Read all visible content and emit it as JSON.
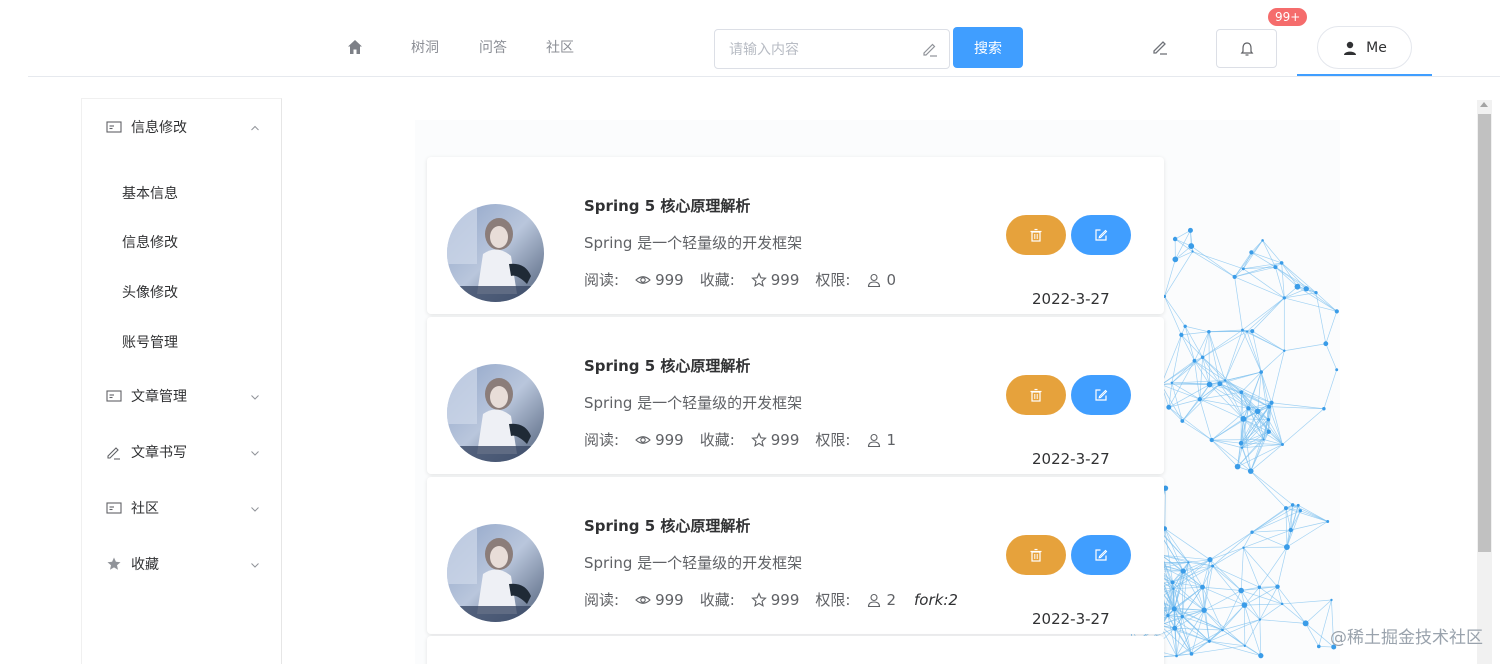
{
  "nav": {
    "links": [
      "树洞",
      "问答",
      "社区"
    ],
    "search_placeholder": "请输入内容",
    "search_button": "搜索",
    "badge": "99+",
    "me_label": "Me"
  },
  "sidebar": {
    "groups": [
      {
        "label": "信息修改",
        "icon": "id-card-icon",
        "expanded": true
      },
      {
        "label": "文章管理",
        "icon": "id-card-icon",
        "expanded": false
      },
      {
        "label": "文章书写",
        "icon": "pen-icon",
        "expanded": false
      },
      {
        "label": "社区",
        "icon": "id-card-icon",
        "expanded": false
      },
      {
        "label": "收藏",
        "icon": "star-icon",
        "expanded": false
      }
    ],
    "sub_items": [
      "基本信息",
      "信息修改",
      "头像修改",
      "账号管理"
    ]
  },
  "articles": [
    {
      "title": "Spring 5 核心原理解析",
      "desc": "Spring 是一个轻量级的开发框架",
      "read_label": "阅读:",
      "reads": "999",
      "fav_label": "收藏:",
      "favs": "999",
      "perm_label": "权限:",
      "perm": "0",
      "fork": "",
      "date": "2022-3-27"
    },
    {
      "title": "Spring 5 核心原理解析",
      "desc": "Spring 是一个轻量级的开发框架",
      "read_label": "阅读:",
      "reads": "999",
      "fav_label": "收藏:",
      "favs": "999",
      "perm_label": "权限:",
      "perm": "1",
      "fork": "",
      "date": "2022-3-27"
    },
    {
      "title": "Spring 5 核心原理解析",
      "desc": "Spring 是一个轻量级的开发框架",
      "read_label": "阅读:",
      "reads": "999",
      "fav_label": "收藏:",
      "favs": "999",
      "perm_label": "权限:",
      "perm": "2",
      "fork": "fork:2",
      "date": "2022-3-27"
    }
  ],
  "watermark": "@稀土掘金技术社区",
  "colors": {
    "primary": "#409eff",
    "warning": "#e6a23c",
    "danger": "#f56c6c"
  }
}
